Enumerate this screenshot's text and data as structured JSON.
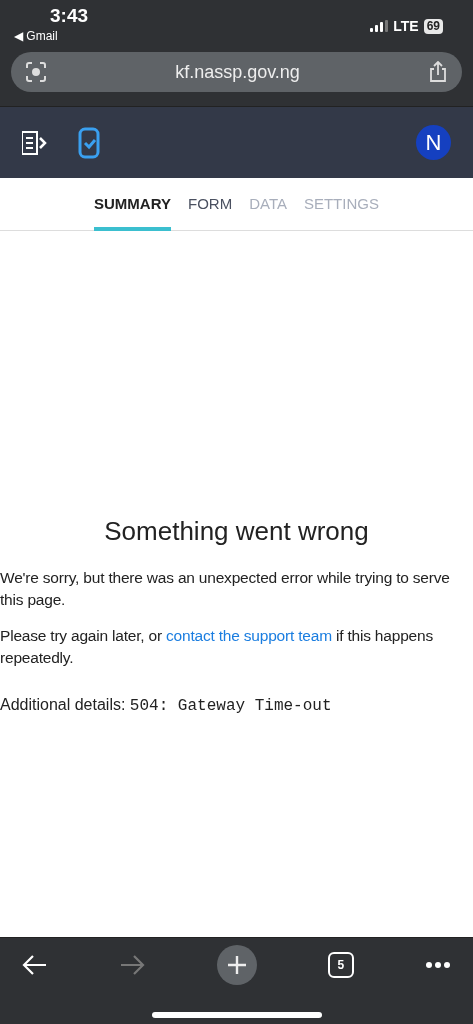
{
  "status_bar": {
    "time": "3:43",
    "back_app": "◀ Gmail",
    "network": "LTE",
    "battery": "69"
  },
  "browser": {
    "url": "kf.nassp.gov.ng"
  },
  "header": {
    "avatar": "N"
  },
  "tabs": [
    {
      "label": "SUMMARY",
      "selected": true,
      "disabled": false
    },
    {
      "label": "FORM",
      "selected": false,
      "disabled": false
    },
    {
      "label": "DATA",
      "selected": false,
      "disabled": true
    },
    {
      "label": "SETTINGS",
      "selected": false,
      "disabled": true
    }
  ],
  "error": {
    "title": "Something went wrong",
    "message": "We're sorry, but there was an unexpected error while trying to serve this page.",
    "retry_before": "Please try again later, or ",
    "retry_link": "contact the support team",
    "retry_after": " if this happens repeatedly.",
    "details_label": "Additional details: ",
    "details_code": "504: Gateway Time-out"
  },
  "toolbar": {
    "back_disabled": false,
    "forward_disabled": true,
    "tab_count": "5"
  }
}
